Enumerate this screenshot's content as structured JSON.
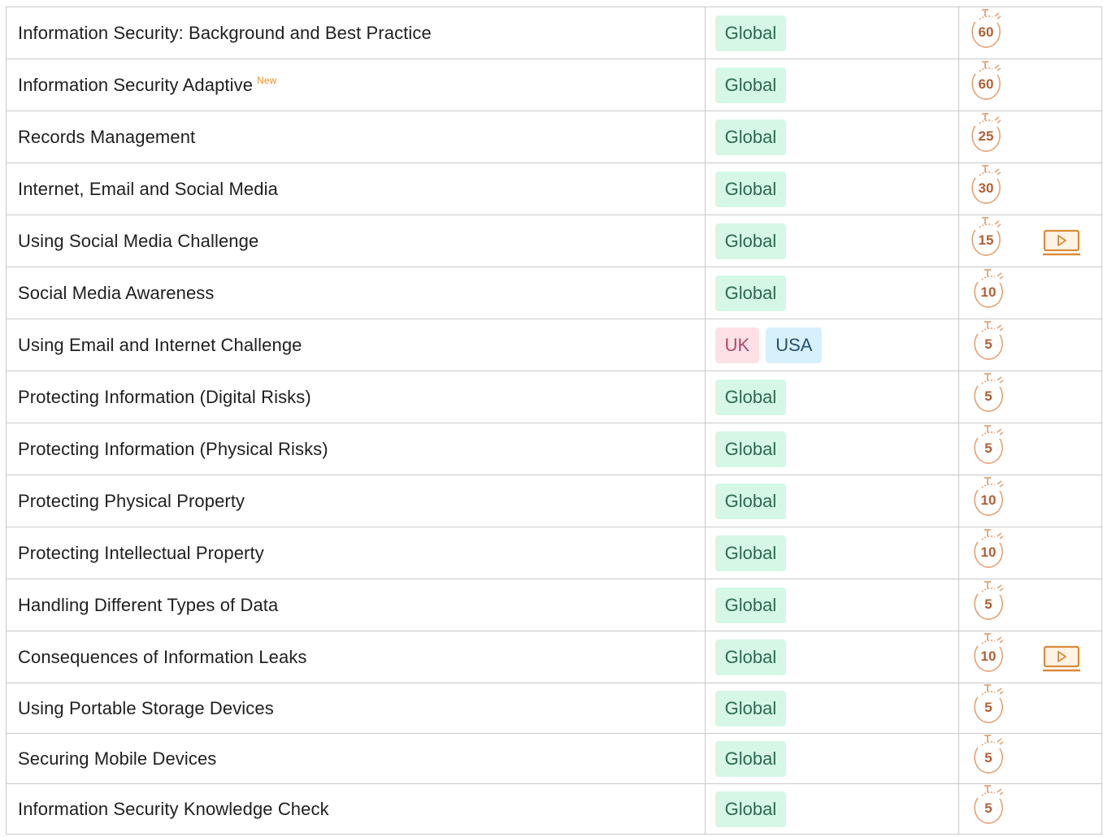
{
  "colors": {
    "border": "#c9c9c9",
    "global_badge_bg": "#d6f7e6",
    "global_badge_text": "#2b6b4b",
    "uk_badge_bg": "#fde1e6",
    "usa_badge_bg": "#d7f1fc",
    "timer": "#e3a274",
    "new_tag": "#f0902a"
  },
  "courses": [
    {
      "title": "Information Security: Background and Best Practice",
      "new": "",
      "regions": [
        "Global"
      ],
      "minutes": "60",
      "video": false
    },
    {
      "title": "Information Security Adaptive",
      "new": "New",
      "regions": [
        "Global"
      ],
      "minutes": "60",
      "video": false
    },
    {
      "title": "Records Management",
      "new": "",
      "regions": [
        "Global"
      ],
      "minutes": "25",
      "video": false
    },
    {
      "title": "Internet, Email and Social Media",
      "new": "",
      "regions": [
        "Global"
      ],
      "minutes": "30",
      "video": false
    },
    {
      "title": "Using Social Media Challenge",
      "new": "",
      "regions": [
        "Global"
      ],
      "minutes": "15",
      "video": true
    },
    {
      "title": "Social Media Awareness",
      "new": "",
      "regions": [
        "Global"
      ],
      "minutes": "10",
      "video": false
    },
    {
      "title": "Using Email and Internet Challenge",
      "new": "",
      "regions": [
        "UK",
        "USA"
      ],
      "minutes": "5",
      "video": false
    },
    {
      "title": "Protecting Information (Digital Risks)",
      "new": "",
      "regions": [
        "Global"
      ],
      "minutes": "5",
      "video": false
    },
    {
      "title": "Protecting Information (Physical Risks)",
      "new": "",
      "regions": [
        "Global"
      ],
      "minutes": "5",
      "video": false
    },
    {
      "title": "Protecting Physical Property",
      "new": "",
      "regions": [
        "Global"
      ],
      "minutes": "10",
      "video": false
    },
    {
      "title": "Protecting Intellectual Property",
      "new": "",
      "regions": [
        "Global"
      ],
      "minutes": "10",
      "video": false
    },
    {
      "title": "Handling Different Types of Data",
      "new": "",
      "regions": [
        "Global"
      ],
      "minutes": "5",
      "video": false
    },
    {
      "title": "Consequences of Information Leaks",
      "new": "",
      "regions": [
        "Global"
      ],
      "minutes": "10",
      "video": true
    },
    {
      "title": "Using Portable Storage Devices",
      "new": "",
      "regions": [
        "Global"
      ],
      "minutes": "5",
      "video": false
    },
    {
      "title": "Securing Mobile Devices",
      "new": "",
      "regions": [
        "Global"
      ],
      "minutes": "5",
      "video": false
    },
    {
      "title": "Information Security Knowledge Check",
      "new": "",
      "regions": [
        "Global"
      ],
      "minutes": "5",
      "video": false
    }
  ]
}
